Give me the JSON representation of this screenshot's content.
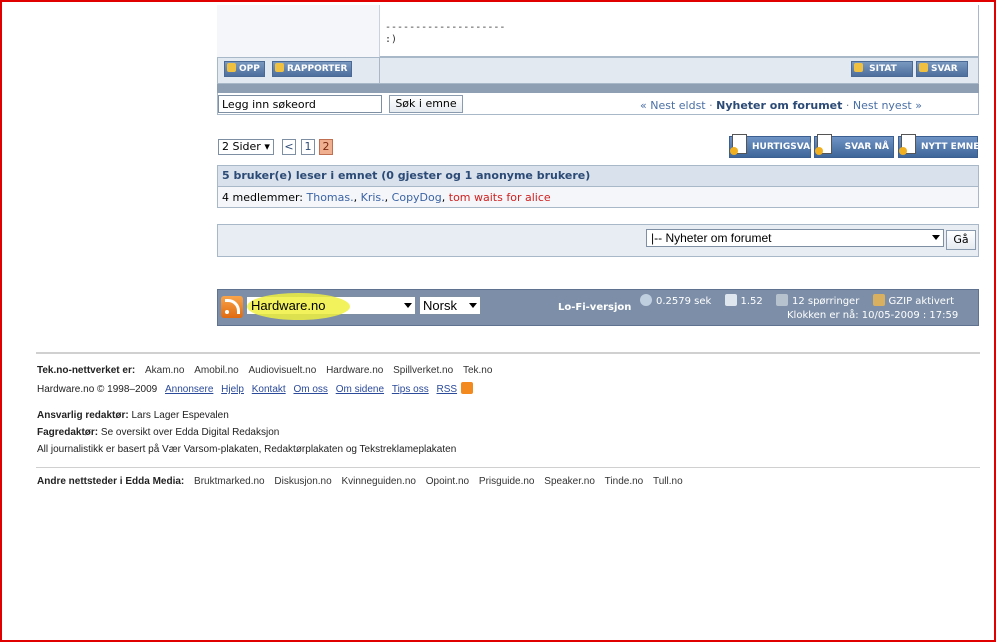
{
  "post": {
    "separator": "--------------------",
    "smiley": ":)",
    "buttons": {
      "up": "OPP",
      "report": "RAPPORTER",
      "quote": "SITAT",
      "reply": "SVAR"
    }
  },
  "search": {
    "placeholder": "Legg inn søkeord",
    "button": "Søk i emne"
  },
  "topic_nav": {
    "prev": "« Nest eldst",
    "sep1": " · ",
    "forum": "Nyheter om forumet",
    "sep2": " · ",
    "next": "Nest nyest »"
  },
  "pagination": {
    "selector": "2 Sider",
    "prev": "<",
    "pages": [
      "1",
      "2"
    ],
    "current": "2"
  },
  "actions": {
    "quick_reply": "HURTIGSVAR",
    "reply_now": "SVAR NÅ",
    "new_topic": "NYTT EMNE"
  },
  "readers": {
    "title": "5 bruker(e) leser i emnet (0 gjester og 1 anonyme brukere)",
    "members_label": "4 medlemmer: ",
    "members": [
      "Thomas.",
      "Kris.",
      "CopyDog",
      "tom waits for alice"
    ],
    "sep": ", "
  },
  "forum_jump": {
    "selected": "|-- Nyheter om forumet",
    "go": "Gå"
  },
  "footer_bar": {
    "site": "Hardware.no",
    "language": "Norsk",
    "lofi": "Lo-Fi-versjon",
    "time": "0.2579 sek",
    "load": "1.52",
    "queries": "12 spørringer",
    "gzip": "GZIP aktivert",
    "clock": "Klokken er nå: 10/05-2009 : 17:59"
  },
  "footer": {
    "network_label": "Tek.no-nettverket er:",
    "network_sites": [
      "Akam.no",
      "Amobil.no",
      "Audiovisuelt.no",
      "Hardware.no",
      "Spillverket.no",
      "Tek.no"
    ],
    "copyright": "Hardware.no © 1998–2009",
    "links": [
      "Annonsere",
      "Hjelp",
      "Kontakt",
      "Om oss",
      "Om sidene",
      "Tips oss",
      "RSS"
    ],
    "editor_label": "Ansvarlig redaktør:",
    "editor": " Lars Lager Espevalen",
    "fag_label": "Fagredaktør:",
    "fag": " Se oversikt over Edda Digital Redaksjon",
    "journalism": "All journalistikk er basert på Vær Varsom-plakaten, Redaktørplakaten og Tekstreklameplakaten",
    "edda_label": "Andre nettsteder i Edda Media:",
    "edda_sites": [
      "Bruktmarked.no",
      "Diskusjon.no",
      "Kvinneguiden.no",
      "Opoint.no",
      "Prisguide.no",
      "Speaker.no",
      "Tinde.no",
      "Tull.no"
    ]
  },
  "colors": {
    "frame": "#e00000",
    "bar": "#7d8fa8",
    "highlight": "#eef040"
  }
}
